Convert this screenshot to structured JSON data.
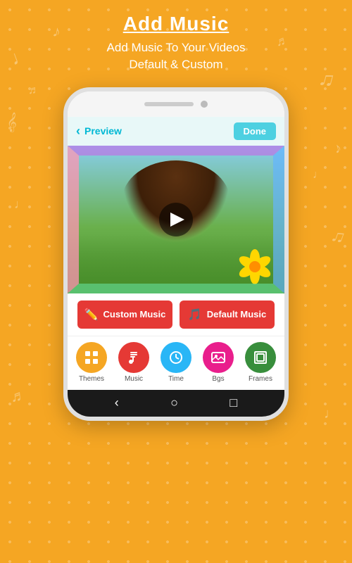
{
  "page": {
    "background_color": "#F5A623"
  },
  "header": {
    "title": "Add Music",
    "subtitle_line1": "Add Music To Your Videos",
    "subtitle_line2": "Default & Custom"
  },
  "phone": {
    "app_bar": {
      "back_label": "Preview",
      "done_label": "Done"
    },
    "music_buttons": {
      "custom_label": "Custom Music",
      "default_label": "Default Music"
    },
    "bottom_nav": {
      "items": [
        {
          "label": "Themes",
          "icon": "grid-icon",
          "color": "#F5A623"
        },
        {
          "label": "Music",
          "icon": "music-icon",
          "color": "#E53935"
        },
        {
          "label": "Time",
          "icon": "clock-icon",
          "color": "#29B6F6"
        },
        {
          "label": "Bgs",
          "icon": "image-icon",
          "color": "#E91E8C"
        },
        {
          "label": "Frames",
          "icon": "frame-icon",
          "color": "#388E3C"
        }
      ]
    },
    "android_bar": {
      "back": "‹",
      "home": "○",
      "recent": "□"
    }
  }
}
